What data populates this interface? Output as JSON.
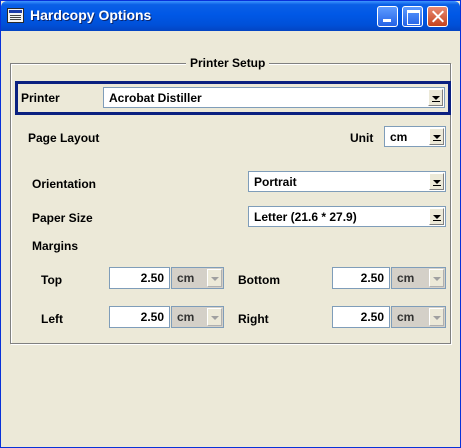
{
  "window": {
    "title": "Hardcopy Options"
  },
  "printer_setup": {
    "caption": "Printer Setup",
    "printer_label": "Printer",
    "printer_value": "Acrobat Distiller"
  },
  "page_layout": {
    "label": "Page Layout",
    "unit_label": "Unit",
    "unit_value": "cm",
    "orientation_label": "Orientation",
    "orientation_value": "Portrait",
    "paper_size_label": "Paper Size",
    "paper_size_value": "Letter (21.6 * 27.9)",
    "margins_label": "Margins",
    "top_label": "Top",
    "top_value": "2.50",
    "top_unit": "cm",
    "bottom_label": "Bottom",
    "bottom_value": "2.50",
    "bottom_unit": "cm",
    "left_label": "Left",
    "left_value": "2.50",
    "left_unit": "cm",
    "right_label": "Right",
    "right_value": "2.50",
    "right_unit": "cm"
  },
  "colors": {
    "titlebar": "#0058e6",
    "window_bg": "#ece9d8",
    "focus_border": "#0a2080"
  }
}
